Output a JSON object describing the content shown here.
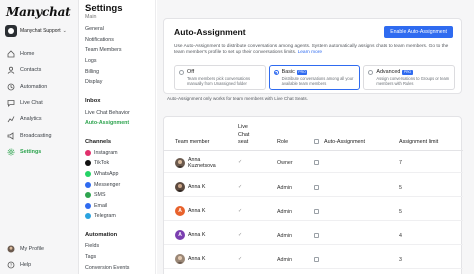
{
  "app": {
    "logo": "Manychat",
    "account_name": "Manychat Support",
    "account_caret": "⌄"
  },
  "nav": {
    "items": [
      {
        "label": "Home",
        "icon": "home-icon"
      },
      {
        "label": "Contacts",
        "icon": "contacts-icon"
      },
      {
        "label": "Automation",
        "icon": "automation-icon"
      },
      {
        "label": "Live Chat",
        "icon": "live-chat-icon"
      },
      {
        "label": "Analytics",
        "icon": "analytics-icon"
      },
      {
        "label": "Broadcasting",
        "icon": "broadcasting-icon"
      },
      {
        "label": "Settings",
        "icon": "settings-icon",
        "active": true
      }
    ],
    "bottom": [
      {
        "label": "My Profile",
        "icon": "profile-icon"
      },
      {
        "label": "Help",
        "icon": "help-icon"
      }
    ]
  },
  "settings_menu": {
    "title": "Settings",
    "cut_item": "Main",
    "main_items": [
      "General",
      "Notifications",
      "Team Members",
      "Logs",
      "Billing",
      "Display"
    ],
    "inbox_heading": "Inbox",
    "inbox_items": [
      "Live Chat Behavior",
      "Auto-Assignment"
    ],
    "channels_heading": "Channels",
    "channels": [
      {
        "label": "Instagram",
        "color": "#e1306c"
      },
      {
        "label": "TikTok",
        "color": "#111111"
      },
      {
        "label": "WhatsApp",
        "color": "#25d366"
      },
      {
        "label": "Messenger",
        "color": "#2f6bf0"
      },
      {
        "label": "SMS",
        "color": "#2ea44f"
      },
      {
        "label": "Email",
        "color": "#2f6bf0"
      },
      {
        "label": "Telegram",
        "color": "#2aa3e0"
      }
    ],
    "automation_heading": "Automation",
    "automation_items": [
      "Fields",
      "Tags",
      "Conversion Events"
    ]
  },
  "auto_assignment": {
    "title": "Auto-Assignment",
    "enable_button": "Enable Auto-Assignment",
    "description": "Use Auto-Assignment to distribute conversations among agents. System automatically assigns chats to team members. Go to the team member's profile to set up their conversations limits.",
    "learn_more": "Learn more",
    "options": [
      {
        "title": "Off",
        "badge": "",
        "desc": "Team members pick conversations manually from Unassigned folder",
        "selected": false
      },
      {
        "title": "Basic",
        "badge": "PRO",
        "desc": "Distribute conversations among all your available team members",
        "selected": true
      },
      {
        "title": "Advanced",
        "badge": "PRO",
        "desc": "Assign conversations to Groups or team members with Rules",
        "selected": false
      }
    ],
    "note": "Auto-Assignment only works for team members with Live Chat Seats."
  },
  "team_table": {
    "headers": {
      "member": "Team member",
      "seat": "Live Chat seat",
      "role": "Role",
      "auto": "Auto-Assignment",
      "limit": "Assignment limit"
    },
    "rows": [
      {
        "name": "Anna Kuznetsova",
        "role": "Owner",
        "limit": "7",
        "avatar": "photo",
        "color": "#6b5a4e"
      },
      {
        "name": "Anna K",
        "role": "Admin",
        "limit": "5",
        "avatar": "photo",
        "color": "#5c4a3f"
      },
      {
        "name": "Anna K",
        "role": "Admin",
        "limit": "5",
        "avatar": "A",
        "color": "#e8622c"
      },
      {
        "name": "Anna K",
        "role": "Admin",
        "limit": "4",
        "avatar": "A",
        "color": "#7b3fb0"
      },
      {
        "name": "Anna K",
        "role": "Admin",
        "limit": "3",
        "avatar": "photo",
        "color": "#9a8776"
      }
    ],
    "seat_mark": "✓"
  }
}
